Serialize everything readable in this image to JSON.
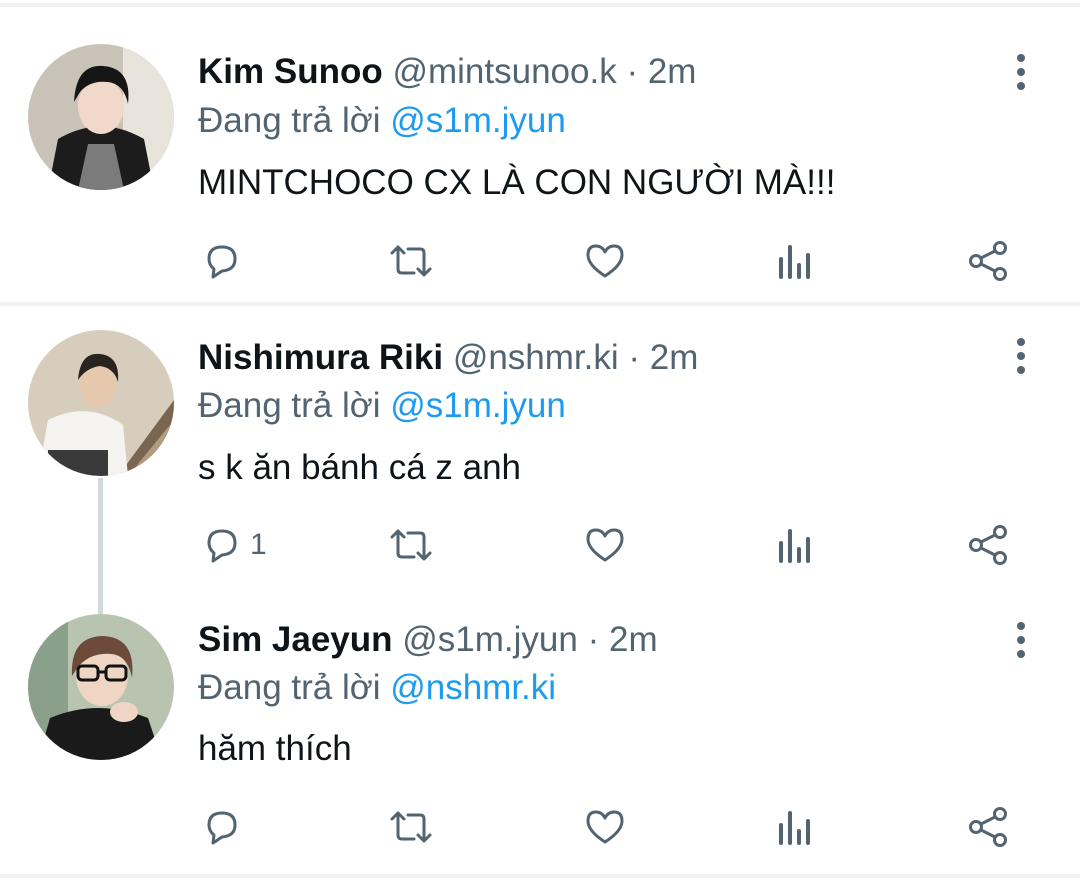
{
  "tweets": [
    {
      "display_name": "Kim Sunoo",
      "handle": "@mintsunoo.k",
      "separator": "·",
      "time": "2m",
      "replying_prefix": "Đang trả lời",
      "replying_to": "@s1m.jyun",
      "text": "MINTCHOCO CX LÀ CON NGƯỜI MÀ!!!",
      "reply_count": ""
    },
    {
      "display_name": "Nishimura Riki",
      "handle": "@nshmr.ki",
      "separator": "·",
      "time": "2m",
      "replying_prefix": "Đang trả lời",
      "replying_to": "@s1m.jyun",
      "text": "s k ăn bánh cá z anh",
      "reply_count": "1"
    },
    {
      "display_name": "Sim Jaeyun",
      "handle": "@s1m.jyun",
      "separator": "·",
      "time": "2m",
      "replying_prefix": "Đang trả lời",
      "replying_to": "@nshmr.ki",
      "text": "hăm thích",
      "reply_count": ""
    }
  ],
  "colors": {
    "text_primary": "#0f1419",
    "text_secondary": "#536471",
    "link": "#1d9bf0",
    "divider": "#eff3f4",
    "thread_line": "#cfd9de"
  },
  "icons": [
    "reply-icon",
    "retweet-icon",
    "like-icon",
    "analytics-icon",
    "share-icon",
    "more-options-icon"
  ]
}
